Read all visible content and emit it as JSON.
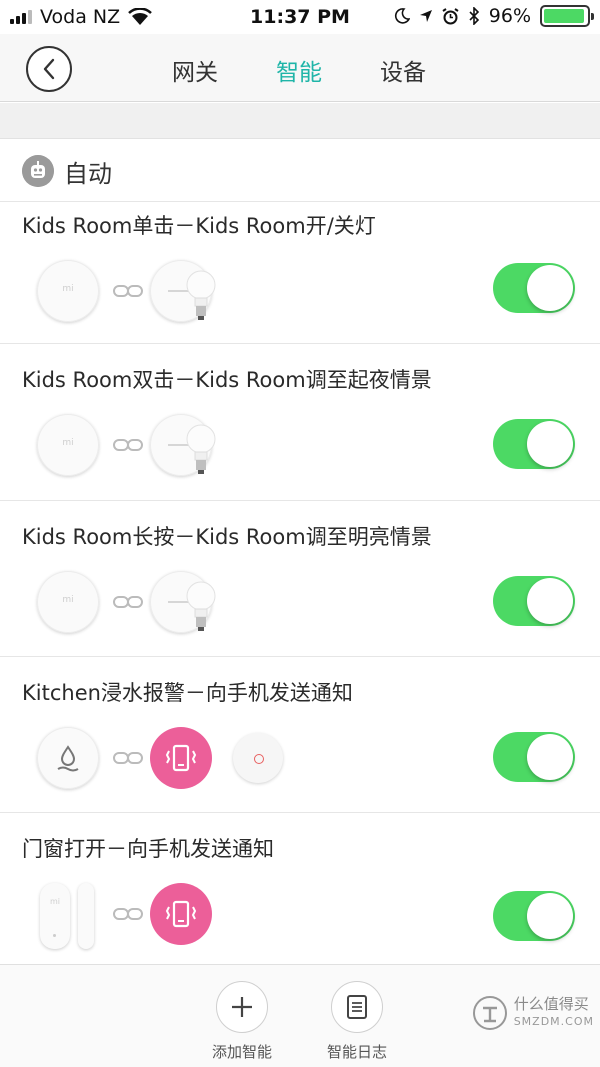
{
  "status_bar": {
    "carrier": "Voda NZ",
    "time": "11:37 PM",
    "battery": "96%",
    "battery_level": 0.96
  },
  "nav": {
    "tabs": [
      "网关",
      "智能",
      "设备"
    ],
    "active_tab": "智能"
  },
  "section": {
    "title": "自动"
  },
  "rules": [
    {
      "title": "Kids Room单击－Kids Room开/关灯",
      "enabled": true
    },
    {
      "title": "Kids Room双击－Kids Room调至起夜情景",
      "enabled": true
    },
    {
      "title": "Kids Room长按－Kids Room调至明亮情景",
      "enabled": true
    },
    {
      "title": "Kitchen浸水报警－向手机发送通知",
      "enabled": true
    },
    {
      "title": "门窗打开－向手机发送通知",
      "enabled": true
    }
  ],
  "device_labels": {
    "mi": "mi"
  },
  "bottom_bar": {
    "add_label": "添加智能",
    "log_label": "智能日志"
  },
  "watermark": {
    "line1": "什么值得买",
    "line2": "SMZDM.COM"
  },
  "colors": {
    "accent": "#1fb5a8",
    "toggle_on": "#4cd964",
    "notify_pink": "#ec5f99"
  }
}
